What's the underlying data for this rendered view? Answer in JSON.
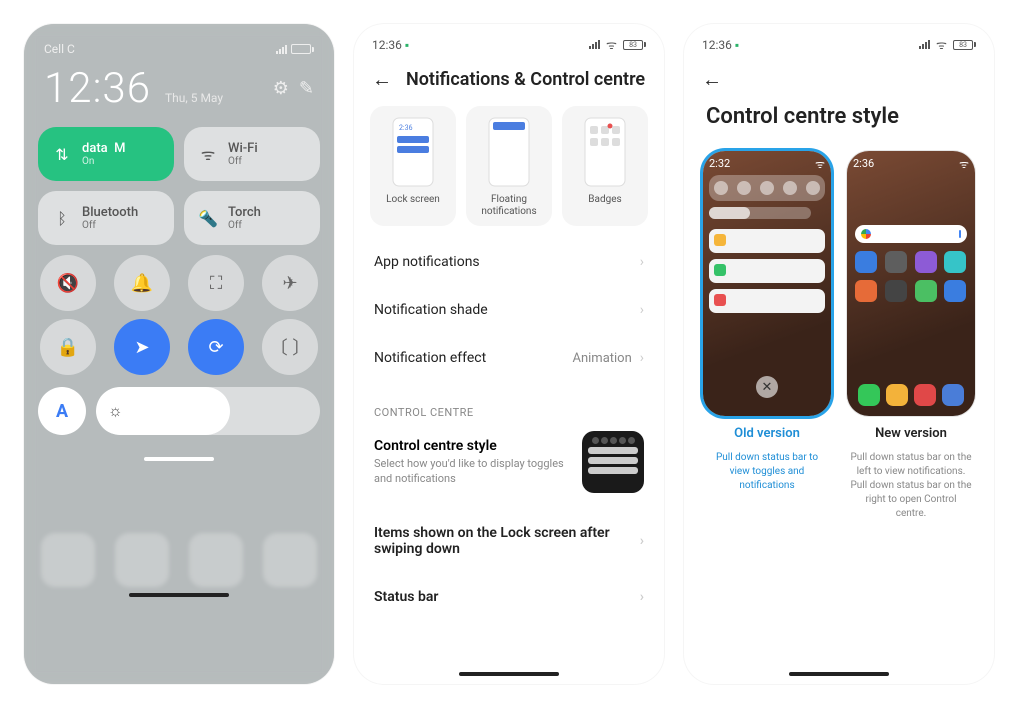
{
  "screen1": {
    "carrier": "Cell C",
    "time": "12:36",
    "date": "Thu, 5 May",
    "tiles": {
      "data": {
        "icon": "⇅",
        "label": "data",
        "extra": "M",
        "status": "On"
      },
      "wifi": {
        "icon": "ᯤ",
        "label": "Wi-Fi",
        "status": "Off"
      },
      "bt": {
        "icon": "ᛒ",
        "label": "Bluetooth",
        "status": "Off"
      },
      "torch": {
        "icon": "🔦",
        "label": "Torch",
        "status": "Off"
      }
    },
    "round": [
      "🔇",
      "🔔",
      "⛶",
      "✈",
      "🔒",
      "➤",
      "⟳",
      "〔 〕"
    ],
    "autoLabel": "A",
    "brightnessIcon": "☼"
  },
  "screen2": {
    "status": {
      "time": "12:36",
      "battery": "83"
    },
    "title": "Notifications & Control centre",
    "cards": [
      "Lock screen",
      "Floating notifications",
      "Badges"
    ],
    "rows": {
      "appNotif": "App notifications",
      "shade": "Notification shade",
      "effect": "Notification effect",
      "effectVal": "Animation"
    },
    "sectionLabel": "CONTROL CENTRE",
    "styleRow": {
      "title": "Control centre style",
      "sub": "Select how you'd like to display toggles and notifications"
    },
    "rows2": {
      "lockItems": "Items shown on the Lock screen after swiping down",
      "statusBar": "Status bar"
    }
  },
  "screen3": {
    "status": {
      "time": "12:36",
      "battery": "83"
    },
    "title": "Control centre style",
    "oldTime": "2:32",
    "newTime": "2:36",
    "closeGlyph": "✕",
    "options": {
      "old": {
        "label": "Old version",
        "desc": "Pull down status bar to view toggles and notifications"
      },
      "new": {
        "label": "New version",
        "desc": "Pull down status bar on the left to view notifications. Pull down status bar on the right to open Control centre."
      }
    },
    "appColors": [
      "#3a7de0",
      "#5e5e5e",
      "#8d5bd6",
      "#36c4c8",
      "#e66b38",
      "#444",
      "#4bbf63",
      "#3a7de0",
      "#34c759",
      "#f3b23a",
      "#e04848",
      "#4a7dd8"
    ]
  }
}
